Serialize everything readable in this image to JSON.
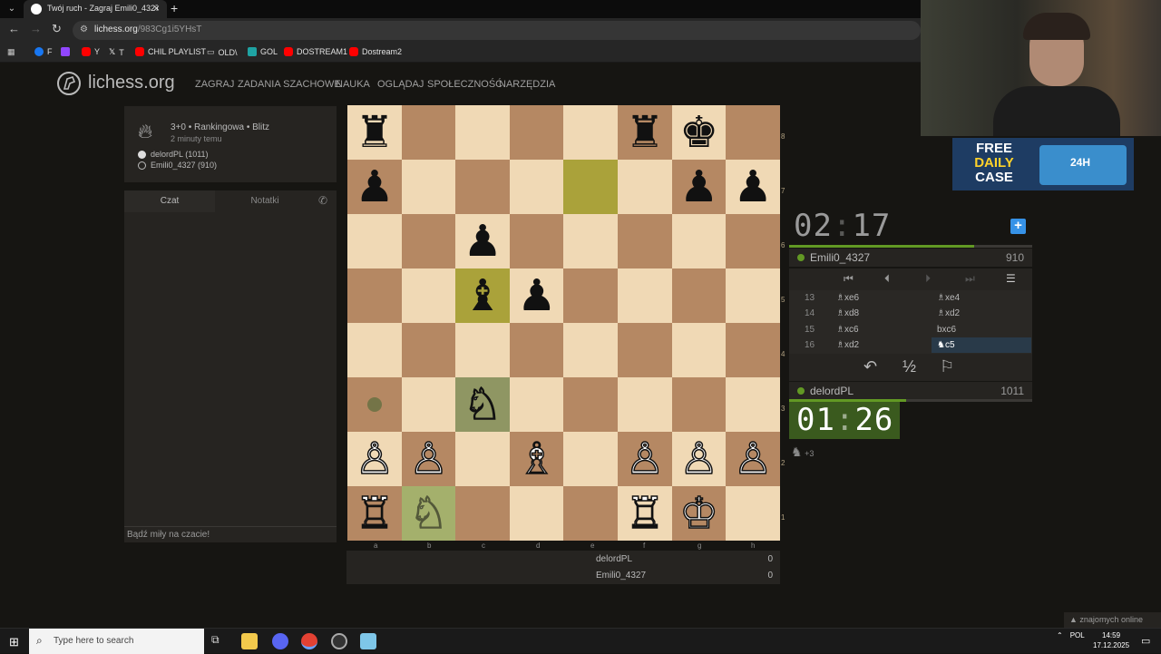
{
  "browser": {
    "tab_title": "Twój ruch - Zagraj Emili0_4327",
    "url_host": "lichess.org",
    "url_path": "/983Cg1i5YHsT",
    "bookmarks": [
      {
        "label": "F",
        "color": "#1877f2"
      },
      {
        "label": "",
        "color": "#9146ff"
      },
      {
        "label": "Y",
        "color": "#ff0000"
      },
      {
        "label": "T",
        "color": "#ffffff"
      },
      {
        "label": "CHIL PLAYLIST",
        "color": "#ff0000"
      },
      {
        "label": "OLD\\",
        "color": "#cccccc"
      },
      {
        "label": "GOL",
        "color": "#1fa3a3"
      },
      {
        "label": "DOSTREAM1",
        "color": "#ff0000"
      },
      {
        "label": "Dostream2",
        "color": "#ff0000"
      }
    ]
  },
  "header": {
    "logo": "lichess.org",
    "menu": [
      "ZAGRAJ",
      "ZADANIA SZACHOWE",
      "NAUKA",
      "OGLĄDAJ",
      "SPOŁECZNOŚĆ",
      "NARZĘDZIA"
    ]
  },
  "game": {
    "mode": "3+0 • Rankingowa • Blitz",
    "time_ago": "2 minuty temu",
    "white_player": "delordPL (1011)",
    "black_player": "Emili0_4327 (910)"
  },
  "chat": {
    "tab_chat": "Czat",
    "tab_notes": "Notatki",
    "placeholder": "Bądź miły na czacie!"
  },
  "board": {
    "ranks": [
      "8",
      "7",
      "6",
      "5",
      "4",
      "3",
      "2",
      "1"
    ],
    "files": [
      "a",
      "b",
      "c",
      "d",
      "e",
      "f",
      "g",
      "h"
    ]
  },
  "material": {
    "rows": [
      {
        "name": "delordPL",
        "score": "0"
      },
      {
        "name": "Emili0_4327",
        "score": "0"
      }
    ]
  },
  "opponent": {
    "clock_min": "02",
    "clock_sec": "17",
    "name": "Emili0_4327",
    "rating": "910",
    "time_fraction": 0.76
  },
  "player": {
    "clock_min": "01",
    "clock_sec": "26",
    "name": "delordPL",
    "rating": "1011",
    "time_fraction": 0.48,
    "extra": "+3"
  },
  "moves": [
    {
      "num": "13",
      "white": "♗xe6",
      "black": "♗xe4"
    },
    {
      "num": "14",
      "white": "♗xd8",
      "black": "♗xd2"
    },
    {
      "num": "15",
      "white": "♗xc6",
      "black": "bxc6"
    },
    {
      "num": "16",
      "white": "♗xd2",
      "black": "♞c5"
    }
  ],
  "ad": {
    "line1": "FREE",
    "line2": "DAILY",
    "line3": "CASE",
    "badge": "24H"
  },
  "friends": "znajomych online",
  "taskbar": {
    "search_placeholder": "Type here to search",
    "lang": "POL",
    "time": "14:59",
    "date": "17.12.2025"
  }
}
